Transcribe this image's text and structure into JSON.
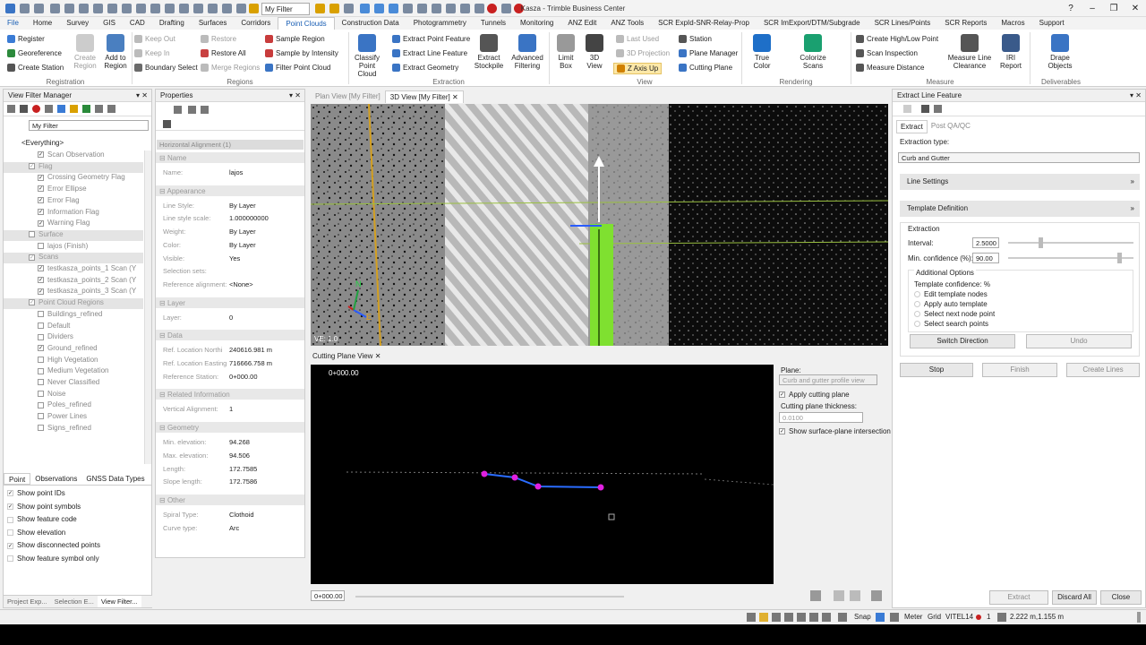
{
  "app": {
    "title": "Kasza - Trimble Business Center",
    "filter": "My Filter"
  },
  "menu_tabs": [
    "File",
    "Home",
    "Survey",
    "GIS",
    "CAD",
    "Drafting",
    "Surfaces",
    "Corridors",
    "Point Clouds",
    "Construction Data",
    "Photogrammetry",
    "Tunnels",
    "Monitoring",
    "ANZ Edit",
    "ANZ Tools",
    "SCR ExpId-SNR-Relay-Prop",
    "SCR ImExport/DTM/Subgrade",
    "SCR Lines/Points",
    "SCR Reports",
    "Macros",
    "Support"
  ],
  "ribbon": {
    "registration": {
      "register": "Register",
      "georeference": "Georeference",
      "create_station": "Create Station",
      "create_region": "Create Region",
      "add_to_region": "Add to Region",
      "group": "Registration"
    },
    "regions": {
      "keep_out": "Keep Out",
      "keep_in": "Keep In",
      "boundary_select": "Boundary Select",
      "restore": "Restore",
      "restore_all": "Restore All",
      "merge_regions": "Merge Regions",
      "sample_region": "Sample Region",
      "sample_by_intensity": "Sample by Intensity",
      "filter_point_cloud": "Filter Point Cloud",
      "group": "Regions"
    },
    "extraction": {
      "classify": "Classify Point Cloud",
      "extract_point_feature": "Extract Point Feature",
      "extract_line_feature": "Extract Line Feature",
      "extract_geometry": "Extract Geometry",
      "extract_stockpile": "Extract Stockpile",
      "advanced_filtering": "Advanced Filtering",
      "group": "Extraction"
    },
    "view": {
      "limit_box": "Limit Box",
      "view_3d": "3D View",
      "last_used": "Last Used",
      "projection_3d": "3D Projection",
      "z_axis_up": "Z Axis Up",
      "station": "Station",
      "plane_manager": "Plane Manager",
      "cutting_plane": "Cutting Plane",
      "group": "View"
    },
    "rendering": {
      "true_color": "True Color",
      "colorize_scans": "Colorize Scans",
      "group": "Rendering"
    },
    "measure": {
      "create_high_low": "Create High/Low Point",
      "scan_inspection": "Scan Inspection",
      "measure_distance": "Measure Distance",
      "measure_line_clearance": "Measure Line Clearance",
      "iri_report": "IRI Report",
      "group": "Measure"
    },
    "deliverables": {
      "drape_objects": "Drape Objects",
      "group": "Deliverables"
    }
  },
  "view_filter": {
    "title": "View Filter Manager",
    "filter_name": "My Filter",
    "everything": "<Everything>",
    "items": [
      {
        "label": "Scan Observation",
        "indent": 2,
        "checked": true,
        "header": false
      },
      {
        "label": "Flag",
        "indent": 1,
        "checked": true,
        "header": true
      },
      {
        "label": "Crossing Geometry Flag",
        "indent": 2,
        "checked": true,
        "header": false
      },
      {
        "label": "Error Ellipse",
        "indent": 2,
        "checked": true,
        "header": false
      },
      {
        "label": "Error Flag",
        "indent": 2,
        "checked": true,
        "header": false
      },
      {
        "label": "Information Flag",
        "indent": 2,
        "checked": true,
        "header": false
      },
      {
        "label": "Warning Flag",
        "indent": 2,
        "checked": true,
        "header": false
      },
      {
        "label": "Surface",
        "indent": 1,
        "checked": false,
        "header": true
      },
      {
        "label": "lajos (Finish)",
        "indent": 2,
        "checked": false,
        "header": false
      },
      {
        "label": "Scans",
        "indent": 1,
        "checked": true,
        "header": true
      },
      {
        "label": "testkasza_points_1 Scan (Y",
        "indent": 2,
        "checked": true,
        "header": false
      },
      {
        "label": "testkasza_points_2 Scan (Y",
        "indent": 2,
        "checked": true,
        "header": false
      },
      {
        "label": "testkasza_points_3 Scan (Y",
        "indent": 2,
        "checked": true,
        "header": false
      },
      {
        "label": "Point Cloud Regions",
        "indent": 1,
        "checked": true,
        "header": true
      },
      {
        "label": "Buildings_refined",
        "indent": 2,
        "checked": false,
        "header": false
      },
      {
        "label": "Default",
        "indent": 2,
        "checked": false,
        "header": false
      },
      {
        "label": "Dividers",
        "indent": 2,
        "checked": false,
        "header": false
      },
      {
        "label": "Ground_refined",
        "indent": 2,
        "checked": true,
        "header": false
      },
      {
        "label": "High Vegetation",
        "indent": 2,
        "checked": false,
        "header": false
      },
      {
        "label": "Medium Vegetation",
        "indent": 2,
        "checked": false,
        "header": false
      },
      {
        "label": "Never Classified",
        "indent": 2,
        "checked": false,
        "header": false
      },
      {
        "label": "Noise",
        "indent": 2,
        "checked": false,
        "header": false
      },
      {
        "label": "Poles_refined",
        "indent": 2,
        "checked": false,
        "header": false
      },
      {
        "label": "Power Lines",
        "indent": 2,
        "checked": false,
        "header": false
      },
      {
        "label": "Signs_refined",
        "indent": 2,
        "checked": false,
        "header": false
      }
    ],
    "lower_tabs": [
      "Point",
      "Observations",
      "GNSS Data Types"
    ],
    "options": [
      {
        "label": "Show point IDs",
        "checked": true
      },
      {
        "label": "Show point symbols",
        "checked": true
      },
      {
        "label": "Show feature code",
        "checked": false
      },
      {
        "label": "Show elevation",
        "checked": false
      },
      {
        "label": "Show disconnected points",
        "checked": true
      },
      {
        "label": "Show feature symbol only",
        "checked": false
      }
    ],
    "bottom_tabs": [
      "Project Exp...",
      "Selection E...",
      "View Filter..."
    ]
  },
  "properties": {
    "title": "Properties",
    "object": "Horizontal Alignment (1)",
    "sections": [
      {
        "name": "Name",
        "rows": [
          {
            "label": "Name:",
            "value": "lajos"
          }
        ]
      },
      {
        "name": "Appearance",
        "rows": [
          {
            "label": "Line Style:",
            "value": "By Layer"
          },
          {
            "label": "Line style scale:",
            "value": "1.000000000"
          },
          {
            "label": "Weight:",
            "value": "By Layer"
          },
          {
            "label": "Color:",
            "value": "By Layer"
          },
          {
            "label": "Visible:",
            "value": "Yes"
          },
          {
            "label": "Selection sets:",
            "value": ""
          },
          {
            "label": "Reference alignment:",
            "value": "<None>"
          }
        ]
      },
      {
        "name": "Layer",
        "rows": [
          {
            "label": "Layer:",
            "value": "0"
          }
        ]
      },
      {
        "name": "Data",
        "rows": [
          {
            "label": "Ref. Location Northi",
            "value": "240616.981 m"
          },
          {
            "label": "Ref. Location Easting",
            "value": "716666.758 m"
          },
          {
            "label": "Reference Station:",
            "value": "0+000.00"
          }
        ]
      },
      {
        "name": "Related Information",
        "rows": [
          {
            "label": "Vertical Alignment:",
            "value": "1"
          }
        ]
      },
      {
        "name": "Geometry",
        "rows": [
          {
            "label": "Min. elevation:",
            "value": "94.268"
          },
          {
            "label": "Max. elevation:",
            "value": "94.506"
          },
          {
            "label": "Length:",
            "value": "172.7585"
          },
          {
            "label": "Slope length:",
            "value": "172.7586"
          }
        ]
      },
      {
        "name": "Other",
        "rows": [
          {
            "label": "Spiral Type:",
            "value": "Clothoid"
          },
          {
            "label": "Curve type:",
            "value": "Arc"
          }
        ]
      }
    ]
  },
  "views": {
    "tabs": [
      "Plan View [My Filter]",
      "3D View [My Filter]"
    ],
    "ve": "VE: 1.0",
    "north": "N",
    "east": "E",
    "cutting_title": "Cutting Plane View",
    "station_top": "0+000.00",
    "station_bottom": "0+000.00",
    "plane_label": "Plane:",
    "plane_value": "Curb and gutter profile view",
    "apply_cutting": "Apply cutting plane",
    "thickness_label": "Cutting plane thickness:",
    "thickness_value": "0.0100",
    "show_surface": "Show surface-plane intersection"
  },
  "extract": {
    "title": "Extract Line Feature",
    "tabs": [
      "Extract",
      "Post QA/QC"
    ],
    "type_label": "Extraction type:",
    "type_value": "Curb and Gutter",
    "line_settings": "Line Settings",
    "template_def": "Template Definition",
    "extraction_label": "Extraction",
    "interval_label": "Interval:",
    "interval_value": "2.5000",
    "minconf_label": "Min. confidence (%):",
    "minconf_value": "90.00",
    "additional": "Additional Options",
    "template_conf": "Template confidence: %",
    "radios": [
      "Edit template nodes",
      "Apply auto template",
      "Select next node point",
      "Select search points"
    ],
    "switch_direction": "Switch Direction",
    "undo": "Undo",
    "stop": "Stop",
    "finish": "Finish",
    "create_lines": "Create Lines",
    "extract_btn": "Extract",
    "discard_all": "Discard All",
    "close": "Close"
  },
  "status": {
    "snap": "Snap",
    "units": "Meter",
    "grid": "Grid",
    "code": "VITEL14",
    "count": "1",
    "coords": "2.222 m,1.155 m"
  },
  "colors": {
    "accent": "#1a5fb4",
    "feature": "#7fe030",
    "profile_line": "#2a6cff",
    "profile_node": "#e020e0"
  }
}
